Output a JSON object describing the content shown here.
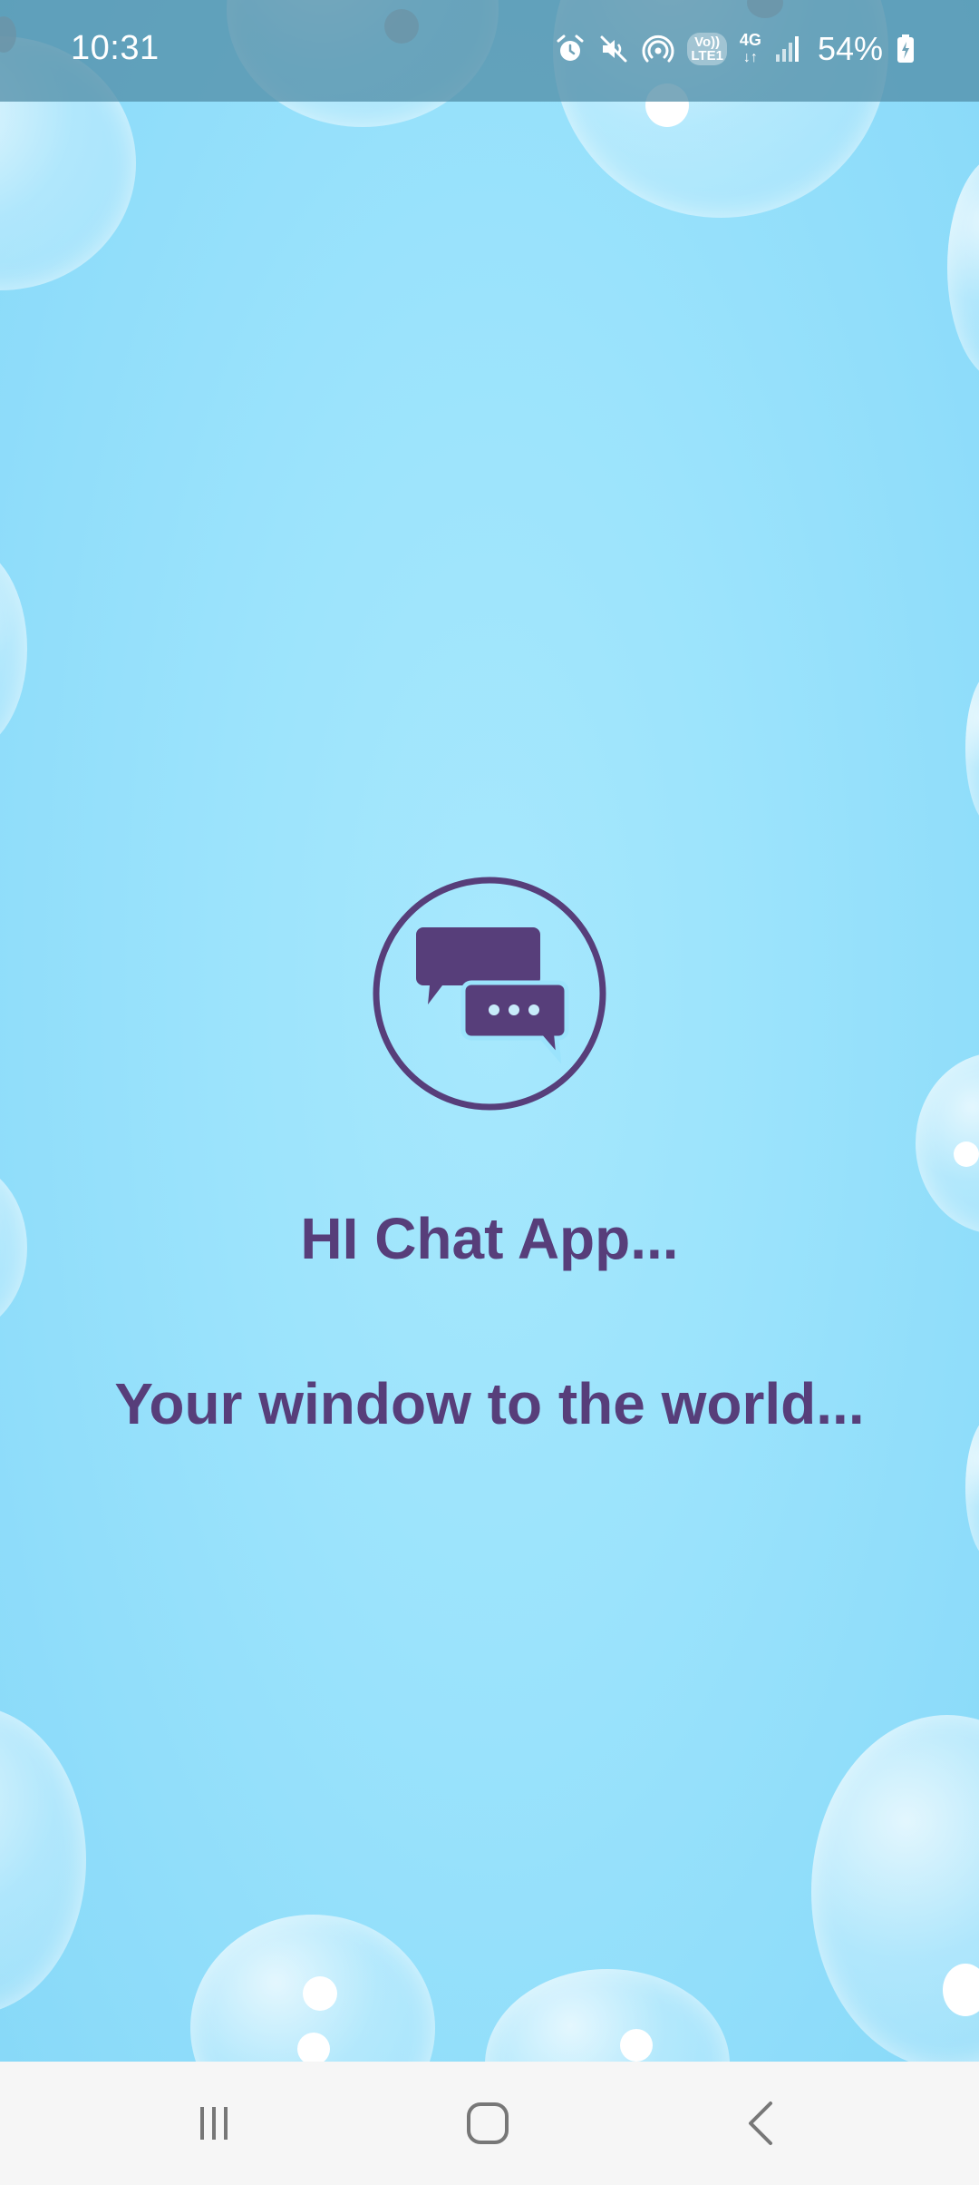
{
  "status_bar": {
    "time": "10:31",
    "volte_top": "Vo))",
    "volte_bottom": "LTE1",
    "network_type": "4G",
    "battery": "54%",
    "icons": [
      "alarm-icon",
      "mute-icon",
      "hotspot-icon",
      "volte-icon",
      "4g-icon",
      "signal-icon",
      "battery-charging-icon"
    ]
  },
  "splash": {
    "title": "HI Chat App...",
    "tagline": "Your window to the world...",
    "logo_icon": "chat-bubbles-icon"
  },
  "nav_bar": {
    "icons": [
      "recent-apps-icon",
      "home-icon",
      "back-icon"
    ]
  },
  "colors": {
    "accent": "#573e7a",
    "background": "#9be3fc",
    "status_bar": "#508ca5",
    "nav_bar": "#f6f6f6"
  }
}
